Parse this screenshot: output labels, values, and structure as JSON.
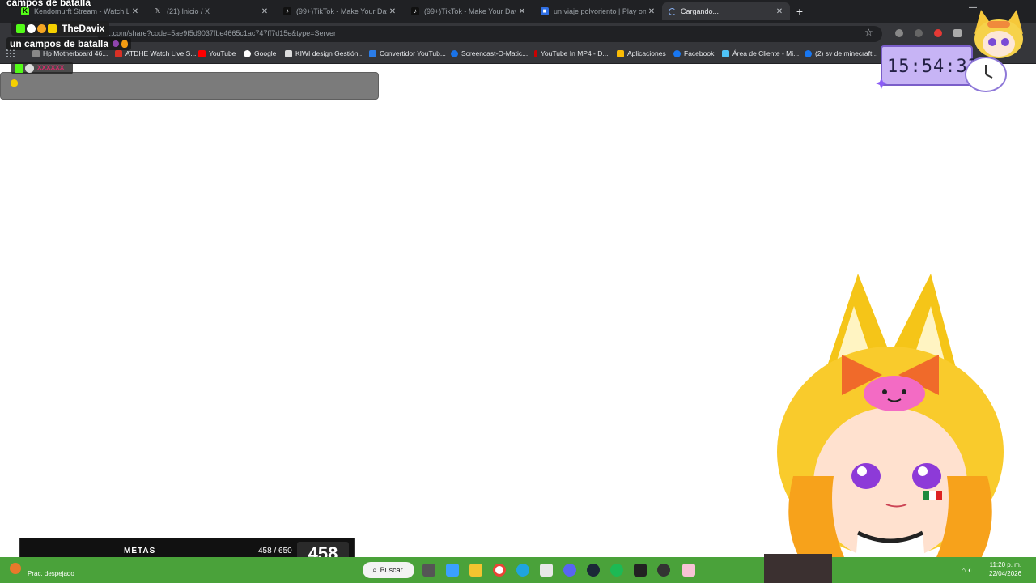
{
  "browser": {
    "tabs": [
      {
        "title": "Kendomurft Stream - Watch Li...",
        "favicon": "kick-icon",
        "color": "#53fc18"
      },
      {
        "title": "(21) Inicio / X",
        "favicon": "x-icon",
        "color": "#000000"
      },
      {
        "title": "(99+)TikTok - Make Your Day",
        "favicon": "tiktok-icon",
        "color": "#111111"
      },
      {
        "title": "(99+)TikTok - Make Your Day",
        "favicon": "tiktok-icon",
        "color": "#111111"
      },
      {
        "title": "un viaje polvoriento | Play on R",
        "favicon": "roblox-icon",
        "color": "#2f6fe4"
      },
      {
        "title": "Cargando...",
        "favicon": "loading-icon",
        "color": "#8ab4f8"
      }
    ],
    "new_tab": "+",
    "url": "...com/share?code=5ae9f5d9037fbe4665c1ac747ff7d15e&type=Server",
    "bookmarks": [
      {
        "label": "Hp Motherboard 46...",
        "color": "#888888"
      },
      {
        "label": "ATDHE Watch Live S...",
        "color": "#d93025"
      },
      {
        "label": "YouTube",
        "color": "#ff0000"
      },
      {
        "label": "Google",
        "color": "#ffffff"
      },
      {
        "label": "KIWI design Gestión...",
        "color": "#dddddd"
      },
      {
        "label": "Convertidor YouTub...",
        "color": "#2b7de9"
      },
      {
        "label": "Screencast-O-Matic...",
        "color": "#1a73e8"
      },
      {
        "label": "YouTube In MP4 - D...",
        "color": "#cc0000"
      },
      {
        "label": "Aplicaciones",
        "color": "#fbbc04"
      },
      {
        "label": "Facebook",
        "color": "#1877f2"
      },
      {
        "label": "Área de Cliente - Mi...",
        "color": "#4fc3f7"
      },
      {
        "label": "(2) sv de minecraft...",
        "color": "#1877f2"
      }
    ]
  },
  "overlay": {
    "title": "campos de batalla",
    "chat_user": "TheDavix",
    "chat_message": "un campos de batalla",
    "chat_user2": "xxxxxx",
    "clock_time": "15:54:33"
  },
  "goal": {
    "label": "METAS",
    "progress_text": "458 / 650",
    "current": 458,
    "target": 650,
    "big_value": "458"
  },
  "taskbar": {
    "weather": "Prac. despejado",
    "search_label": "Buscar",
    "time": "11:20 p. m.",
    "date": "22/04/2026"
  },
  "colors": {
    "accent_green": "#3fd47a",
    "taskbar_green": "#4aa23a",
    "clock_purple": "#c7b4f5"
  }
}
